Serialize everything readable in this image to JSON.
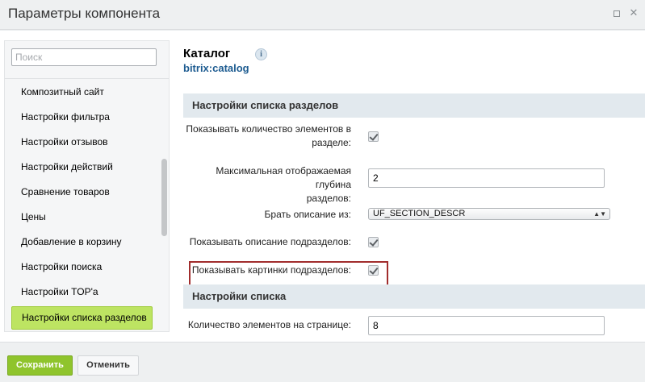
{
  "window": {
    "title": "Параметры компонента"
  },
  "sidebar": {
    "search_placeholder": "Поиск",
    "items": [
      {
        "label": "Композитный сайт"
      },
      {
        "label": "Настройки фильтра"
      },
      {
        "label": "Настройки отзывов"
      },
      {
        "label": "Настройки действий"
      },
      {
        "label": "Сравнение товаров"
      },
      {
        "label": "Цены"
      },
      {
        "label": "Добавление в корзину"
      },
      {
        "label": "Настройки поиска"
      },
      {
        "label": "Настройки TOP'а"
      },
      {
        "label": "Настройки списка разделов",
        "active": true
      }
    ]
  },
  "component": {
    "name": "Каталог",
    "code": "bitrix:catalog",
    "info_icon": "i"
  },
  "sections": [
    {
      "title": "Настройки списка разделов",
      "fields": [
        {
          "label_line1": "Показывать количество элементов в",
          "label_line2": "разделе:",
          "type": "checkbox",
          "checked": true
        },
        {
          "label_line1": "Максимальная отображаемая глубина",
          "label_line2": "разделов:",
          "type": "text",
          "value": "2"
        },
        {
          "label": "Брать описание из:",
          "type": "select",
          "value": "UF_SECTION_DESCR"
        },
        {
          "label": "Показывать описание подразделов:",
          "type": "checkbox",
          "checked": true,
          "highlighted": true
        },
        {
          "label": "Показывать картинки подразделов:",
          "type": "checkbox",
          "checked": true
        }
      ]
    },
    {
      "title": "Настройки списка",
      "fields": [
        {
          "label": "Количество элементов на странице:",
          "type": "text",
          "value": "8"
        }
      ]
    }
  ],
  "footer": {
    "save_label": "Сохранить",
    "cancel_label": "Отменить"
  },
  "colors": {
    "active_item": "#bde462",
    "save_button": "#8fc42c",
    "highlight_border": "#a12d2d",
    "link_blue": "#1e5c91"
  }
}
